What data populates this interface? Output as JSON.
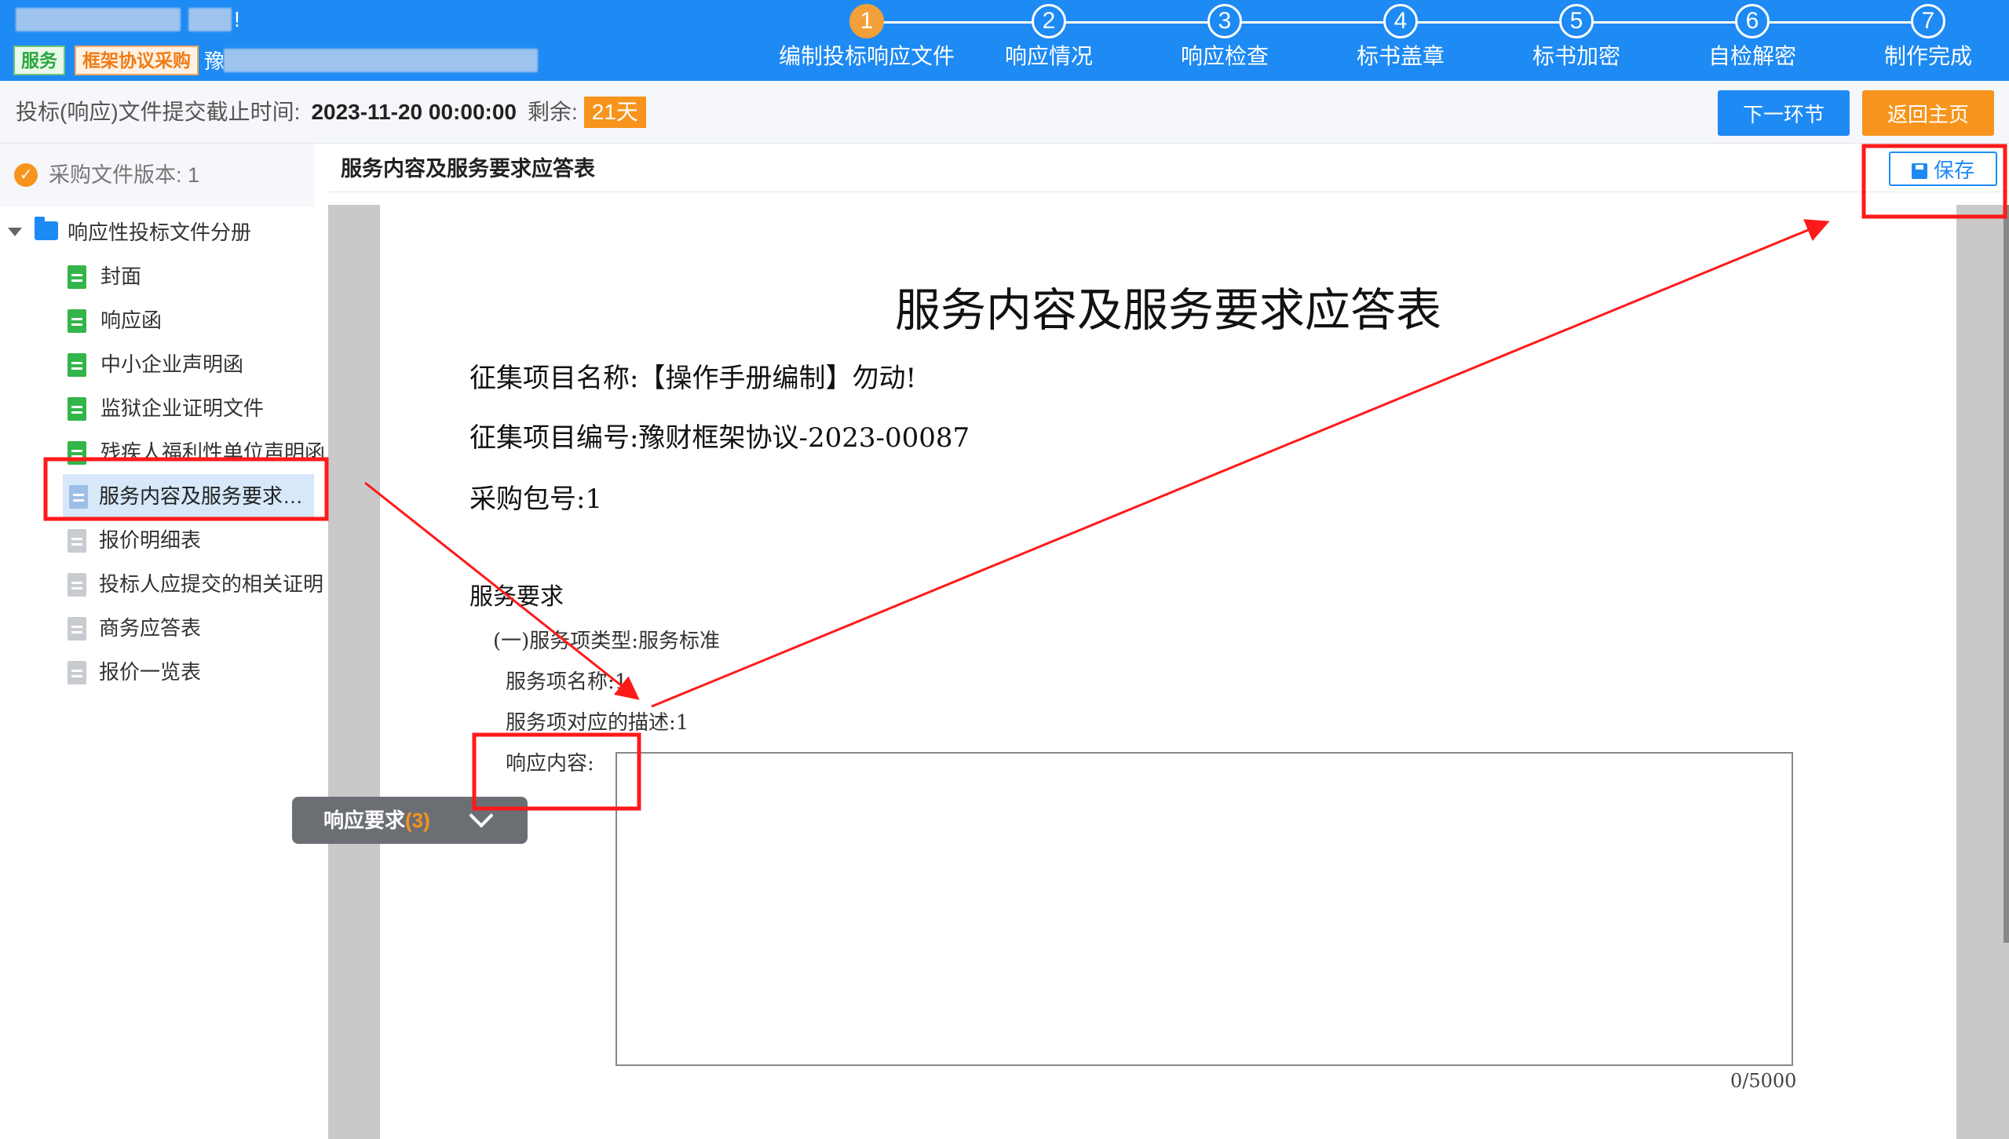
{
  "header": {
    "project_title_suffix": "!",
    "tags": [
      "服务",
      "框架协议采购"
    ],
    "project_prefix": "豫",
    "steps": [
      {
        "num": "1",
        "label": "编制投标响应文件",
        "active": true
      },
      {
        "num": "2",
        "label": "响应情况",
        "active": false
      },
      {
        "num": "3",
        "label": "响应检查",
        "active": false
      },
      {
        "num": "4",
        "label": "标书盖章",
        "active": false
      },
      {
        "num": "5",
        "label": "标书加密",
        "active": false
      },
      {
        "num": "6",
        "label": "自检解密",
        "active": false
      },
      {
        "num": "7",
        "label": "制作完成",
        "active": false
      }
    ]
  },
  "toolbar": {
    "deadline_label": "投标(响应)文件提交截止时间:",
    "deadline_value": "2023-11-20 00:00:00",
    "remaining_label": "剩余:",
    "remaining_value": "21天",
    "next_button": "下一环节",
    "home_button": "返回主页"
  },
  "sidebar": {
    "version_label": "采购文件版本: 1",
    "folder_label": "响应性投标文件分册",
    "items": [
      {
        "label": "封面",
        "icon": "green"
      },
      {
        "label": "响应函",
        "icon": "green"
      },
      {
        "label": "中小企业声明函",
        "icon": "green"
      },
      {
        "label": "监狱企业证明文件",
        "icon": "green"
      },
      {
        "label": "残疾人福利性单位声明函",
        "icon": "green"
      },
      {
        "label": "服务内容及服务要求应...",
        "icon": "active"
      },
      {
        "label": "报价明细表",
        "icon": "grey"
      },
      {
        "label": "投标人应提交的相关证明",
        "icon": "grey"
      },
      {
        "label": "商务应答表",
        "icon": "grey"
      },
      {
        "label": "报价一览表",
        "icon": "grey"
      }
    ]
  },
  "main": {
    "doc_title": "服务内容及服务要求应答表",
    "save_button": "保存",
    "page": {
      "title": "服务内容及服务要求应答表",
      "project_name": "征集项目名称:【操作手册编制】勿动!",
      "project_code": "征集项目编号:豫财框架协议-2023-00087",
      "package_no": "采购包号:1",
      "section_heading": "服务要求",
      "service_type": "(一)服务项类型:服务标准",
      "service_name": "服务项名称:1",
      "service_desc": "服务项对应的描述:1",
      "response_label": "响应内容:",
      "response_value": "",
      "char_counter": "0/5000"
    },
    "float_panel": {
      "label": "响应要求",
      "count": "(3)"
    }
  },
  "colors": {
    "primary": "#1e8af3",
    "accent": "#f7941d",
    "annotation": "#ff1a1a"
  }
}
